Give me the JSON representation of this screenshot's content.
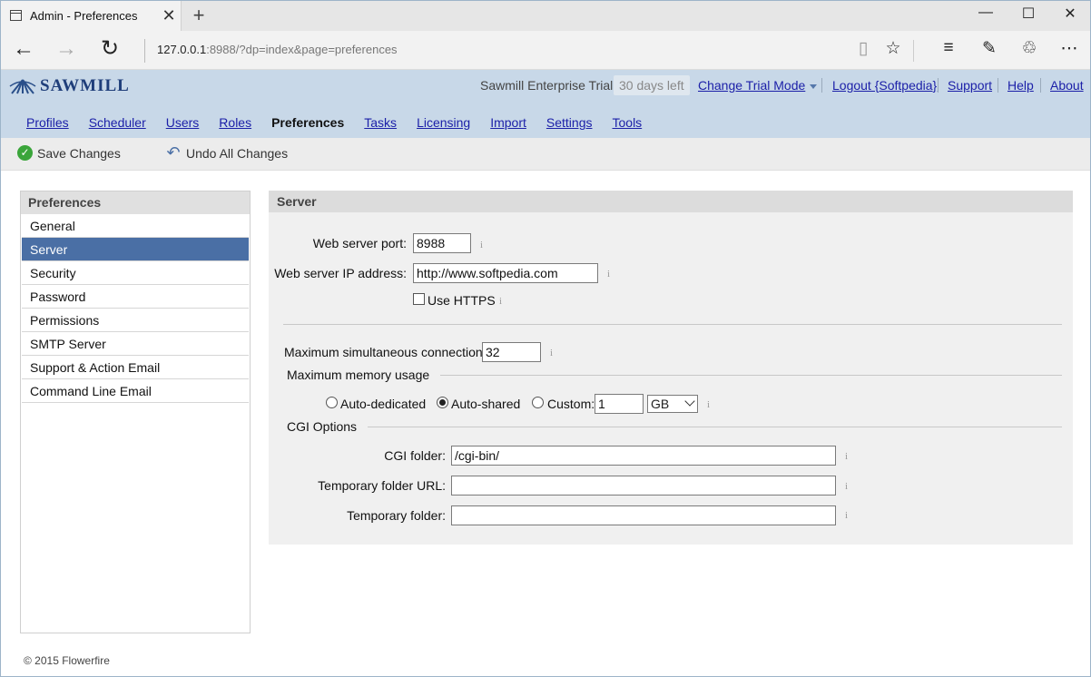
{
  "browser": {
    "tab_title": "Admin - Preferences",
    "address_host": "127.0.0.1",
    "address_rest": ":8988/?dp=index&page=preferences"
  },
  "header": {
    "logo_text": "SAWMILL",
    "trial_name": "Sawmill Enterprise Trial",
    "trial_badge": "30 days left",
    "change_trial": "Change Trial Mode",
    "logout": "Logout {Softpedia}",
    "support": "Support",
    "help": "Help",
    "about": "About"
  },
  "nav": [
    "Profiles",
    "Scheduler",
    "Users",
    "Roles",
    "Preferences",
    "Tasks",
    "Licensing",
    "Import",
    "Settings",
    "Tools"
  ],
  "nav_active": "Preferences",
  "actions": {
    "save": "Save Changes",
    "undo": "Undo All Changes"
  },
  "sidebar": {
    "title": "Preferences",
    "items": [
      "General",
      "Server",
      "Security",
      "Password",
      "Permissions",
      "SMTP Server",
      "Support & Action Email",
      "Command Line Email"
    ],
    "selected": "Server"
  },
  "panel": {
    "title": "Server",
    "port_label": "Web server port:",
    "port_value": "8988",
    "ip_label": "Web server IP address:",
    "ip_value": "http://www.softpedia.com",
    "https_label": "Use HTTPS",
    "https_checked": false,
    "maxconn_label": "Maximum simultaneous connections:",
    "maxconn_value": "32",
    "memory_section": "Maximum memory usage",
    "mem_auto_dedicated": "Auto-dedicated",
    "mem_auto_shared": "Auto-shared",
    "mem_custom": "Custom:",
    "mem_selected": "Auto-shared",
    "mem_custom_value": "1",
    "mem_unit": "GB",
    "cgi_section": "CGI Options",
    "cgi_folder_label": "CGI folder:",
    "cgi_folder_value": "/cgi-bin/",
    "temp_url_label": "Temporary folder URL:",
    "temp_url_value": "",
    "temp_folder_label": "Temporary folder:",
    "temp_folder_value": "",
    "info_glyph": "i"
  },
  "footer": "© 2015 Flowerfire",
  "icons": {
    "back": "←",
    "forward": "→",
    "refresh": "↻",
    "reading": "▯",
    "favorite": "☆",
    "hub": "≡",
    "note": "✎",
    "share": "♲",
    "more": "⋯",
    "minimize": "—",
    "maximize": "☐",
    "close": "✕",
    "newtab": "+",
    "tabclose": "✕",
    "check": "✓",
    "undo": "↶"
  },
  "colors": {
    "header_bg": "#c8d8e8",
    "selected_bg": "#4a6fa5",
    "link": "#1b1fa8"
  }
}
